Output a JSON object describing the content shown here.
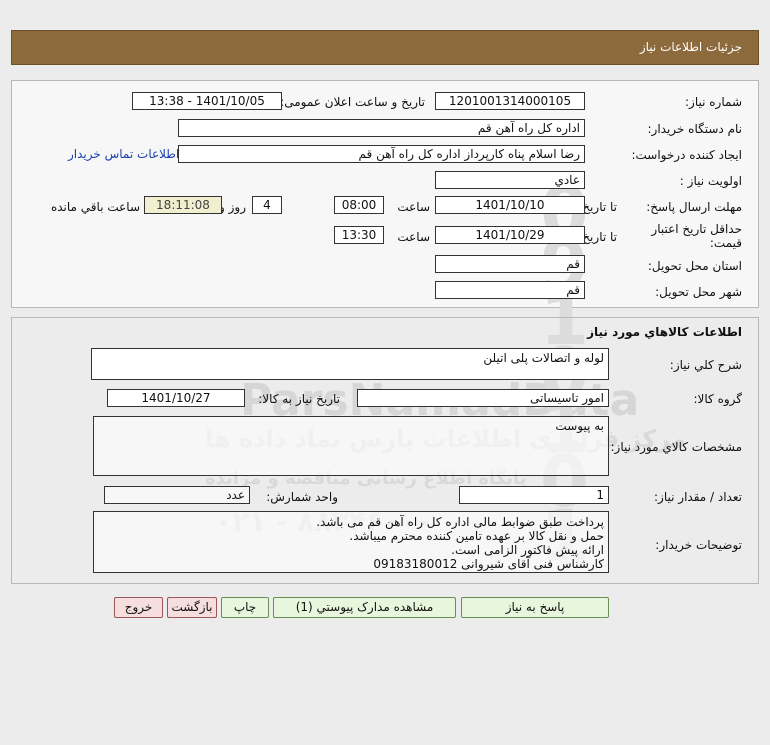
{
  "header": {
    "title": "جزئيات اطلاعات نياز"
  },
  "info": {
    "need_number_label": "شماره نياز:",
    "need_number": "1201001314000105",
    "announce_label": "تاريخ و ساعت اعلان عمومی:",
    "announce_value": "1401/10/05 - 13:38",
    "buyer_org_label": "نام دستگاه خريدار:",
    "buyer_org": "اداره کل  راه آهن قم",
    "requester_label": "ايجاد کننده درخواست:",
    "requester": "رضا اسلام پناه کارپرداز اداره کل  راه آهن قم",
    "contact_link": "اطلاعات تماس خريدار",
    "priority_label": "اولويت نياز :",
    "priority": "عادي",
    "deadline_label": "مهلت ارسال پاسخ:",
    "until_date_label": "تا تاريخ :",
    "deadline_date": "1401/10/10",
    "time_label": "ساعت",
    "deadline_time": "08:00",
    "days_value": "4",
    "days_label": "روز و",
    "remaining_time": "18:11:08",
    "remaining_label": "ساعت باقي مانده",
    "validity_label_1": "حداقل تاريخ اعتبار",
    "validity_label_2": "قيمت:",
    "validity_until_label": "تا تاريخ :",
    "validity_date": "1401/10/29",
    "validity_time_label": "ساعت",
    "validity_time": "13:30",
    "province_label": "استان محل تحويل:",
    "province": "قم",
    "city_label": "شهر محل تحويل:",
    "city": "قم"
  },
  "goods": {
    "section_title": "اطلاعات کالاهاي مورد نياز",
    "summary_label": "شرح کلي نياز:",
    "summary": "لوله و اتصالات پلی اتیلن",
    "group_label": "گروه کالا:",
    "group": "امور تاسیساتی",
    "need_date_label": "تاريخ نياز به کالا:",
    "need_date": "1401/10/27",
    "specs_label": "مشخصات کالاي مورد نياز:",
    "specs": "به پیوست",
    "qty_label": "تعداد / مقدار نياز:",
    "qty": "1",
    "unit_label": "واحد شمارش:",
    "unit": "عدد",
    "notes_label": "توضيحات خريدار:",
    "notes": [
      "پرداخت طبق ضوابط مالی اداره کل راه آهن قم می باشد.",
      "حمل و نقل کالا بر عهده تامین کننده محترم میباشد.",
      "ارائه پیش فاکتور الزامی است.",
      "کارشناس فنی آقای شیروانی 09183180012"
    ]
  },
  "buttons": {
    "reply": "پاسخ به نياز",
    "attachments": "مشاهده مدارک پيوستي (1)",
    "print": "چاپ",
    "back": "بازگشت",
    "exit": "خروج"
  },
  "watermark": {
    "brand": "ParsNamadData",
    "line1": "مرکز فرآوری اطلاعات پارس نماد داده ها",
    "line2": "پایگاه اطلاع رسانی مناقصه و مزایده",
    "phone": "۰۲۱ - ۸۸۳۴۶۰۰۰"
  }
}
